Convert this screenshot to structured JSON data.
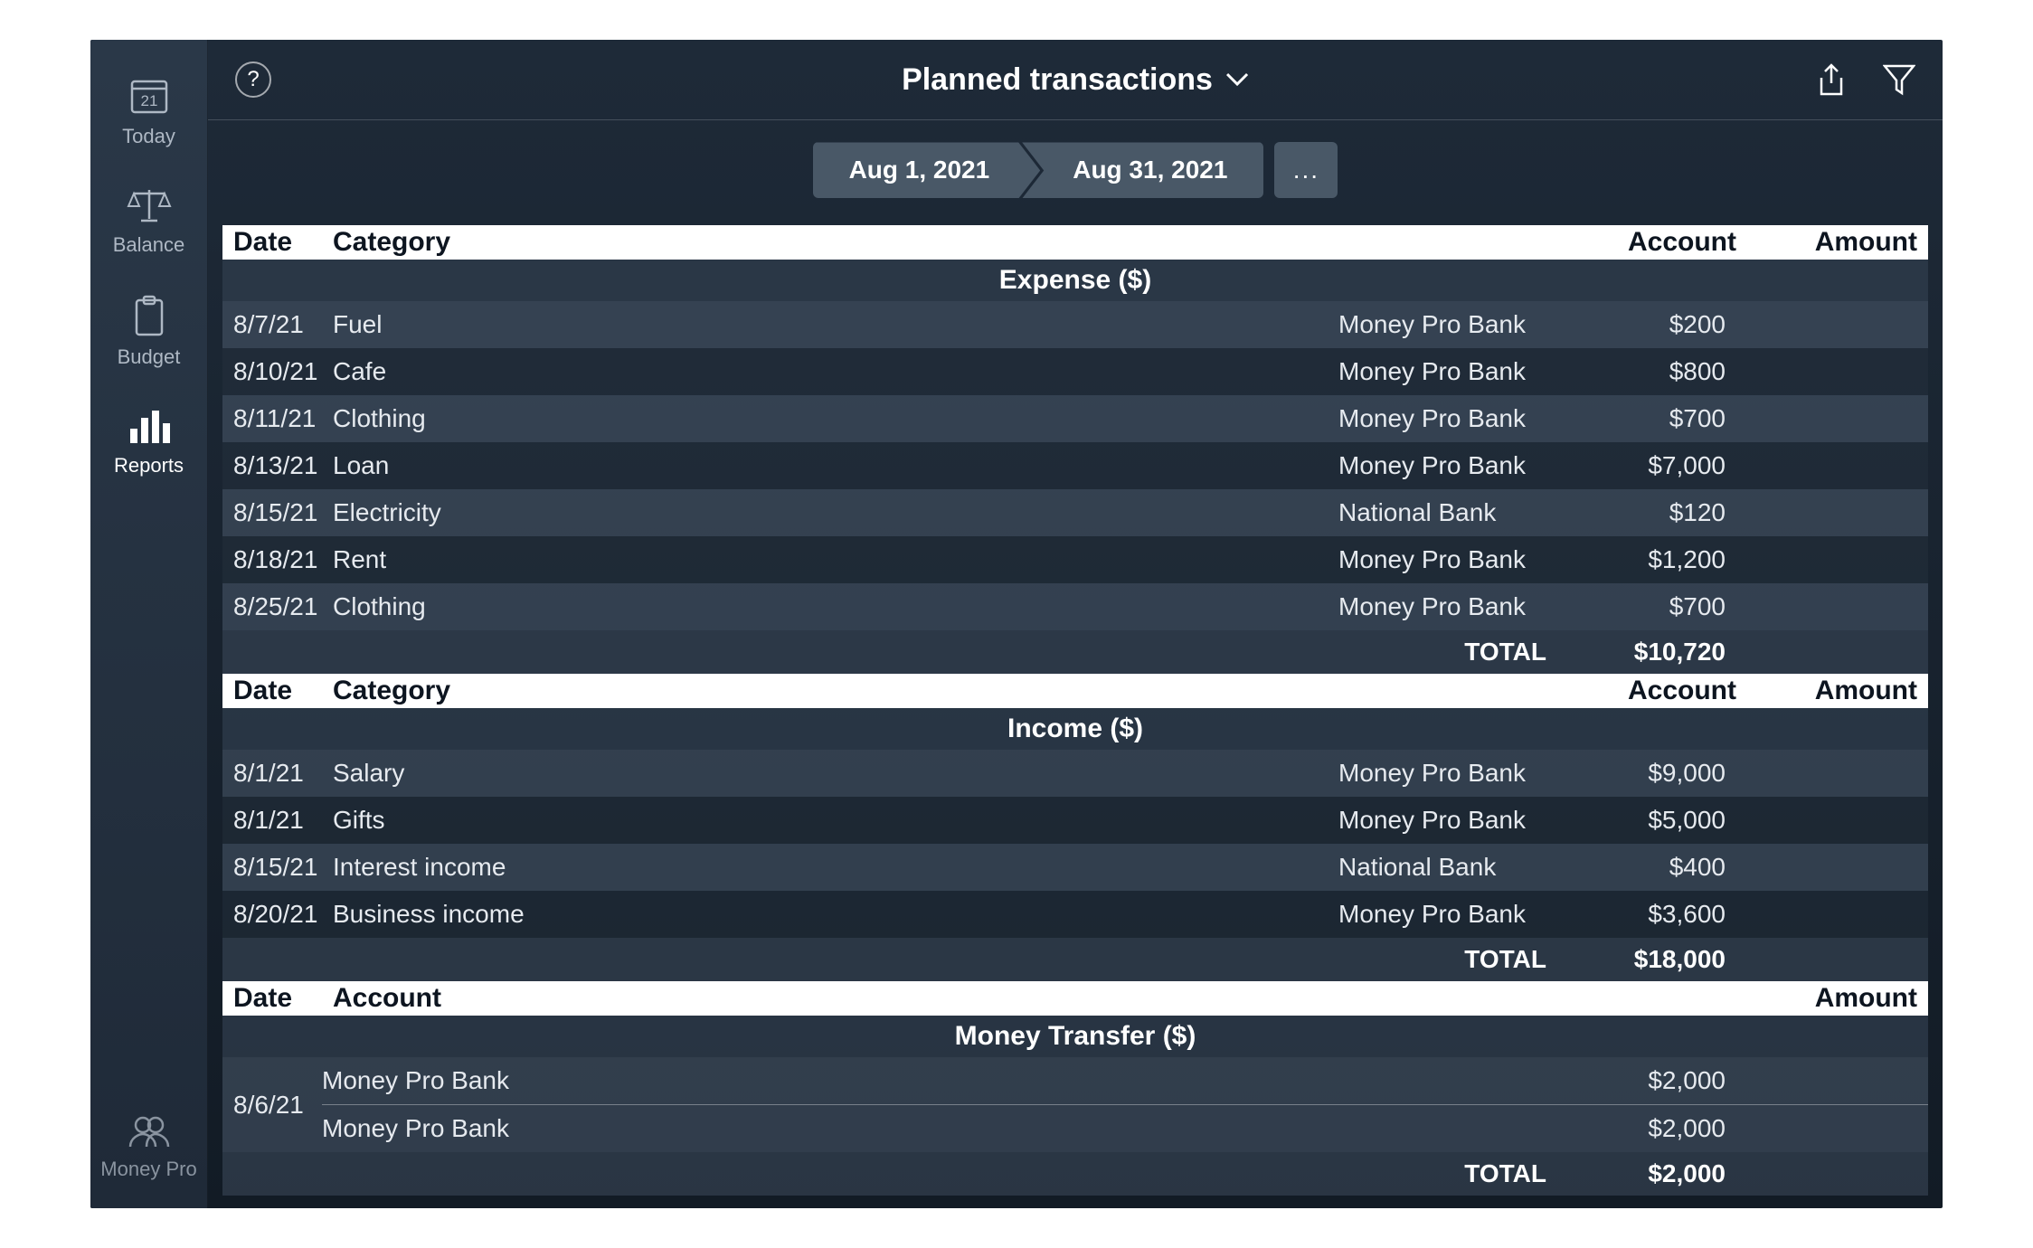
{
  "sidebar": {
    "items": [
      {
        "label": "Today",
        "icon": "calendar-21-icon"
      },
      {
        "label": "Balance",
        "icon": "scale-icon"
      },
      {
        "label": "Budget",
        "icon": "clipboard-icon"
      },
      {
        "label": "Reports",
        "icon": "bar-chart-icon"
      }
    ],
    "calendar_day": "21",
    "bottom": {
      "label": "Money Pro",
      "icon": "profile-icon"
    }
  },
  "header": {
    "title": "Planned transactions",
    "help_icon": "help-icon",
    "share_icon": "share-icon",
    "filter_icon": "filter-icon",
    "dropdown_icon": "chevron-down-icon"
  },
  "date_range": {
    "start": "Aug 1, 2021",
    "end": "Aug 31, 2021",
    "more": "..."
  },
  "columns": {
    "date": "Date",
    "category": "Category",
    "account": "Account",
    "amount": "Amount"
  },
  "sections": [
    {
      "title": "Expense ($)",
      "rows": [
        {
          "date": "8/7/21",
          "category": "Fuel",
          "account": "Money Pro Bank",
          "amount": "$200"
        },
        {
          "date": "8/10/21",
          "category": "Cafe",
          "account": "Money Pro Bank",
          "amount": "$800"
        },
        {
          "date": "8/11/21",
          "category": "Clothing",
          "account": "Money Pro Bank",
          "amount": "$700"
        },
        {
          "date": "8/13/21",
          "category": "Loan",
          "account": "Money Pro Bank",
          "amount": "$7,000"
        },
        {
          "date": "8/15/21",
          "category": "Electricity",
          "account": "National Bank",
          "amount": "$120"
        },
        {
          "date": "8/18/21",
          "category": "Rent",
          "account": "Money Pro Bank",
          "amount": "$1,200"
        },
        {
          "date": "8/25/21",
          "category": "Clothing",
          "account": "Money Pro Bank",
          "amount": "$700"
        }
      ],
      "total_label": "TOTAL",
      "total": "$10,720"
    },
    {
      "title": "Income ($)",
      "rows": [
        {
          "date": "8/1/21",
          "category": "Salary",
          "account": "Money Pro Bank",
          "amount": "$9,000"
        },
        {
          "date": "8/1/21",
          "category": "Gifts",
          "account": "Money Pro Bank",
          "amount": "$5,000"
        },
        {
          "date": "8/15/21",
          "category": "Interest income",
          "account": "National Bank",
          "amount": "$400"
        },
        {
          "date": "8/20/21",
          "category": "Business income",
          "account": "Money Pro Bank",
          "amount": "$3,600"
        }
      ],
      "total_label": "TOTAL",
      "total": "$18,000"
    }
  ],
  "transfer_section": {
    "header_date": "Date",
    "header_account": "Account",
    "header_amount": "Amount",
    "title": "Money Transfer ($)",
    "date": "8/6/21",
    "lines": [
      {
        "account": "Money Pro Bank",
        "amount": "$2,000"
      },
      {
        "account": "Money Pro Bank",
        "amount": "$2,000"
      }
    ],
    "total_label": "TOTAL",
    "total": "$2,000"
  }
}
